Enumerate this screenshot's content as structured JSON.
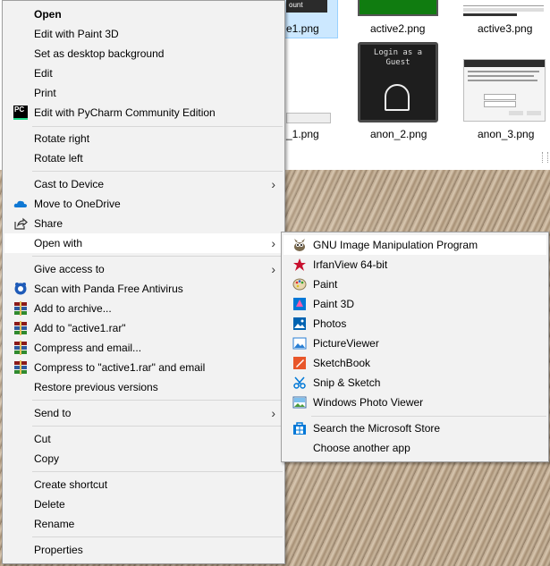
{
  "explorer": {
    "files": [
      {
        "name": "e1.png"
      },
      {
        "name": "active2.png"
      },
      {
        "name": "active3.png"
      },
      {
        "name": "_1.png"
      },
      {
        "name": "anon_2.png",
        "thumb_text": "Login as a Guest"
      },
      {
        "name": "anon_3.png"
      }
    ],
    "thumb_button_text": "ount"
  },
  "menu": {
    "items": [
      {
        "label": "Open",
        "bold": true
      },
      {
        "label": "Edit with Paint 3D"
      },
      {
        "label": "Set as desktop background"
      },
      {
        "label": "Edit"
      },
      {
        "label": "Print"
      },
      {
        "label": "Edit with PyCharm Community Edition",
        "icon": "PC"
      },
      {
        "label": "Rotate right"
      },
      {
        "label": "Rotate left"
      },
      {
        "label": "Cast to Device"
      },
      {
        "label": "Move to OneDrive"
      },
      {
        "label": "Share"
      },
      {
        "label": "Open with"
      },
      {
        "label": "Give access to"
      },
      {
        "label": "Scan with Panda Free Antivirus"
      },
      {
        "label": "Add to archive..."
      },
      {
        "label": "Add to \"active1.rar\""
      },
      {
        "label": "Compress and email..."
      },
      {
        "label": "Compress to \"active1.rar\" and email"
      },
      {
        "label": "Restore previous versions"
      },
      {
        "label": "Send to"
      },
      {
        "label": "Cut"
      },
      {
        "label": "Copy"
      },
      {
        "label": "Create shortcut"
      },
      {
        "label": "Delete"
      },
      {
        "label": "Rename"
      },
      {
        "label": "Properties"
      }
    ]
  },
  "submenu": {
    "items": [
      {
        "label": "GNU Image Manipulation Program"
      },
      {
        "label": "IrfanView 64-bit"
      },
      {
        "label": "Paint"
      },
      {
        "label": "Paint 3D"
      },
      {
        "label": "Photos"
      },
      {
        "label": "PictureViewer"
      },
      {
        "label": "SketchBook"
      },
      {
        "label": "Snip & Sketch"
      },
      {
        "label": "Windows Photo Viewer"
      },
      {
        "label": "Search the Microsoft Store"
      },
      {
        "label": "Choose another app"
      }
    ]
  },
  "colors": {
    "menu_bg": "#f2f2f2",
    "highlight": "#ffffff",
    "separator": "#d7d7d7",
    "pycharm": "#21d789",
    "onedrive": "#0f78d4",
    "winrar": "#8b1a1a",
    "panda": "#1e5bb8"
  }
}
